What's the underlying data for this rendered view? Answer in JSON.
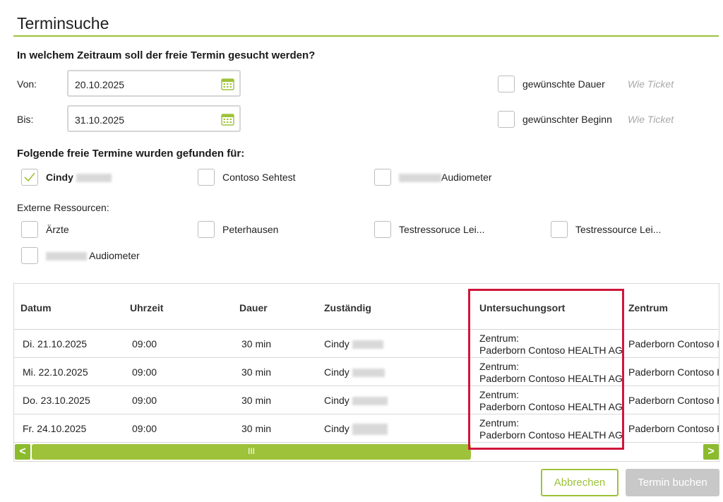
{
  "title": "Terminsuche",
  "period": {
    "heading": "In welchem Zeitraum soll der freie Termin gesucht werden?",
    "from_label": "Von:",
    "from_value": "20.10.2025",
    "to_label": "Bis:",
    "to_value": "31.10.2025",
    "duration_label": "gewünschte Dauer",
    "duration_hint": "Wie Ticket",
    "start_label": "gewünschter Beginn",
    "start_hint": "Wie Ticket"
  },
  "found": {
    "heading": "Folgende freie Termine wurden gefunden für:",
    "resources": [
      {
        "label": "Cindy",
        "checked": true
      },
      {
        "label": "Contoso Sehtest",
        "checked": false
      },
      {
        "label": "Audiometer",
        "checked": false
      }
    ]
  },
  "external": {
    "heading": "Externe Ressourcen:",
    "items": [
      {
        "label": "Ärzte"
      },
      {
        "label": "Peterhausen"
      },
      {
        "label": "Testressoruce Lei..."
      },
      {
        "label": "Testressource Lei..."
      },
      {
        "label": "Audiometer"
      }
    ]
  },
  "table": {
    "headers": [
      "Datum",
      "Uhrzeit",
      "Dauer",
      "Zuständig",
      "Untersuchungsort",
      "Zentrum"
    ],
    "rows": [
      {
        "datum": "Di. 21.10.2025",
        "uhrzeit": "09:00",
        "dauer": "30 min",
        "zustaendig": "Cindy",
        "ort_line1": "Zentrum:",
        "ort_line2": "Paderborn Contoso HEALTH AG",
        "zentrum": "Paderborn Contoso HEALTH AG"
      },
      {
        "datum": "Mi. 22.10.2025",
        "uhrzeit": "09:00",
        "dauer": "30 min",
        "zustaendig": "Cindy",
        "ort_line1": "Zentrum:",
        "ort_line2": "Paderborn Contoso HEALTH AG",
        "zentrum": "Paderborn Contoso HEALTH AG"
      },
      {
        "datum": "Do. 23.10.2025",
        "uhrzeit": "09:00",
        "dauer": "30 min",
        "zustaendig": "Cindy",
        "ort_line1": "Zentrum:",
        "ort_line2": "Paderborn Contoso HEALTH AG",
        "zentrum": "Paderborn Contoso HEALTH AG"
      },
      {
        "datum": "Fr. 24.10.2025",
        "uhrzeit": "09:00",
        "dauer": "30 min",
        "zustaendig": "Cindy",
        "ort_line1": "Zentrum:",
        "ort_line2": "Paderborn Contoso HEALTH AG",
        "zentrum": "Paderborn Contoso HEALTH AG"
      }
    ],
    "scroll_left": "<",
    "scroll_right": ">",
    "scroll_grip": "III"
  },
  "buttons": {
    "cancel": "Abbrechen",
    "book": "Termin buchen"
  },
  "colors": {
    "accent": "#9ec23a",
    "highlight": "#d0163b",
    "disabled": "#c8c8c8"
  }
}
